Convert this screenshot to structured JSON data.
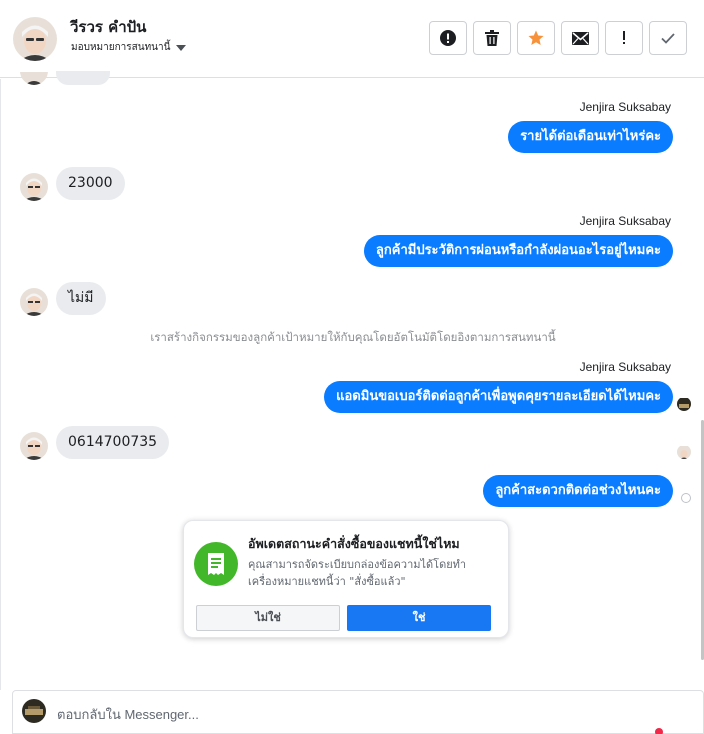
{
  "header": {
    "name": "วีรวร คำปัน",
    "assign_label": "มอบหมายการสนทนานี้",
    "actions": [
      {
        "icon": "alert-circle-icon",
        "label": "mark-spam"
      },
      {
        "icon": "trash-icon",
        "label": "delete"
      },
      {
        "icon": "star-icon",
        "label": "star"
      },
      {
        "icon": "envelope-icon",
        "label": "mark-unread"
      },
      {
        "icon": "exclamation-icon",
        "label": "follow-up"
      },
      {
        "icon": "check-icon",
        "label": "done"
      }
    ]
  },
  "messages": {
    "m1_sender": "Jenjira Suksabay",
    "m1_text": "รายได้ต่อเดือนเท่าไหร่คะ",
    "m2_text": "23000",
    "m3_sender": "Jenjira Suksabay",
    "m3_text": "ลูกค้ามีประวัติการผ่อนหรือกำลังผ่อนอะไรอยู่ไหมคะ",
    "m4_text": "ไม่มี",
    "system_note": "เราสร้างกิจกรรมของลูกค้าเป้าหมายให้กับคุณโดยอัตโนมัติโดยอิงตามการสนทนานี้",
    "m5_sender": "Jenjira Suksabay",
    "m5_text": "แอดมินขอเบอร์ติดต่อลูกค้าเพื่อพูดคุยรายละเอียดได้ไหมคะ",
    "m6_text": "0614700735",
    "m7_text": "ลูกค้าสะดวกติดต่อช่วงไหนคะ"
  },
  "order_card": {
    "title": "อัพเดตสถานะคำสั่งซื้อของแชทนี้ใช่ไหม",
    "description": "คุณสามารถจัดระเบียบกล่องข้อความได้โดยทำเครื่องหมายแชทนี้ว่า \"สั่งซื้อแล้ว\"",
    "no_label": "ไม่ใช่",
    "yes_label": "ใช่",
    "icon": "receipt-icon"
  },
  "composer": {
    "placeholder": "ตอบกลับใน Messenger..."
  },
  "colors": {
    "accent": "#0a7cff",
    "button_blue": "#1877f2",
    "bubble_gray": "#e9ebee",
    "card_green": "#42b72a"
  }
}
